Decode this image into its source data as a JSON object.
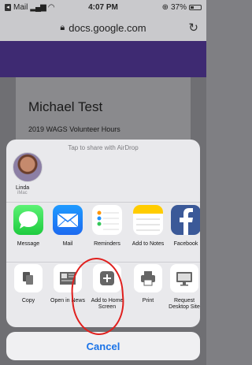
{
  "status_bar": {
    "back_app": "Mail",
    "time": "4:07 PM",
    "battery": "37%",
    "battery_level": 0.37
  },
  "browser": {
    "url": "docs.google.com"
  },
  "doc": {
    "title": "Michael Test",
    "subtitle": "2019 WAGS Volunteer Hours"
  },
  "share_sheet": {
    "airdrop_hint": "Tap to share with AirDrop",
    "contact": {
      "name": "Linda",
      "device": "iMac"
    },
    "apps": [
      {
        "label": "Message",
        "icon": "messages-icon"
      },
      {
        "label": "Mail",
        "icon": "mail-icon"
      },
      {
        "label": "Reminders",
        "icon": "reminders-icon"
      },
      {
        "label": "Add to Notes",
        "icon": "notes-icon"
      },
      {
        "label": "Facebook",
        "icon": "facebook-icon"
      }
    ],
    "actions": [
      {
        "label": "Copy",
        "icon": "copy-icon"
      },
      {
        "label": "Open in News",
        "icon": "news-icon"
      },
      {
        "label": "Add to Home Screen",
        "icon": "add-square-icon"
      },
      {
        "label": "Print",
        "icon": "printer-icon"
      },
      {
        "label": "Request Desktop Site",
        "icon": "desktop-icon"
      }
    ],
    "cancel_label": "Cancel"
  },
  "colors": {
    "accent": "#1a73e8",
    "annotation": "#e0201e",
    "page_header": "#3e2a72"
  }
}
